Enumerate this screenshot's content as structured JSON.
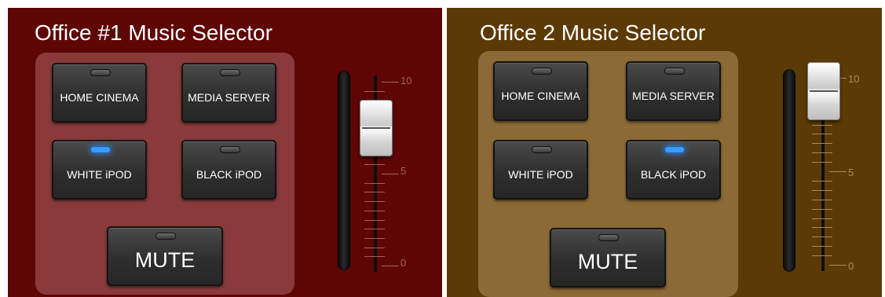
{
  "panels": [
    {
      "title": "Office #1 Music Selector",
      "bg_color": "#5e0606",
      "group_color": "#8a3a3a",
      "tick_color": "#a86060",
      "buttons": [
        {
          "label": "HOME CINEMA",
          "active": false
        },
        {
          "label": "MEDIA SERVER",
          "active": false
        },
        {
          "label": "WHITE iPOD",
          "active": true
        },
        {
          "label": "BLACK iPOD",
          "active": false
        }
      ],
      "mute_label": "MUTE",
      "volume": {
        "value": 7.5,
        "max": 10,
        "labels": [
          "10",
          "5",
          "0"
        ]
      }
    },
    {
      "title": "Office 2 Music Selector",
      "bg_color": "#5c3a06",
      "group_color": "#8c6a36",
      "tick_color": "#a88a5a",
      "buttons": [
        {
          "label": "HOME CINEMA",
          "active": false
        },
        {
          "label": "MEDIA SERVER",
          "active": false
        },
        {
          "label": "WHITE iPOD",
          "active": false
        },
        {
          "label": "BLACK iPOD",
          "active": true
        }
      ],
      "mute_label": "MUTE",
      "volume": {
        "value": 10,
        "max": 10,
        "labels": [
          "10",
          "5",
          "0"
        ]
      }
    }
  ]
}
